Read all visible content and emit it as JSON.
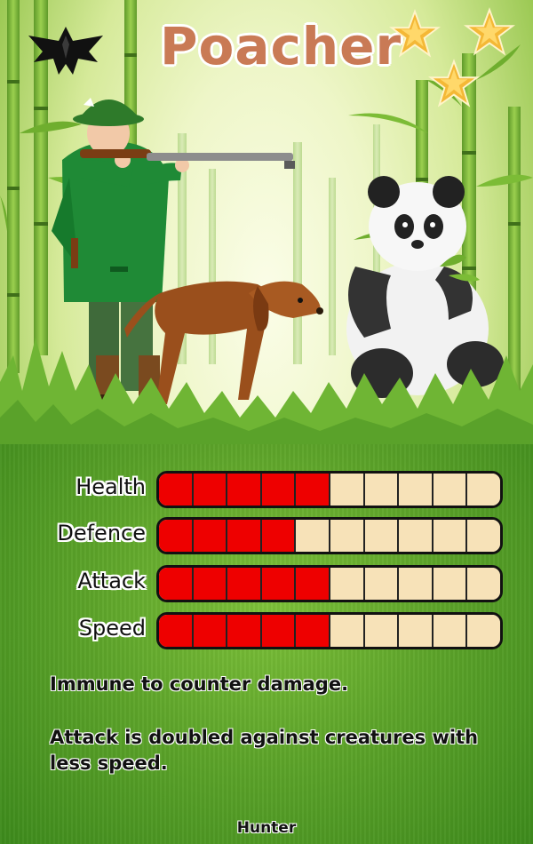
{
  "card": {
    "title": "Poacher",
    "star_count": 3,
    "stats": [
      {
        "label": "Health",
        "value": 5,
        "max": 10
      },
      {
        "label": "Defence",
        "value": 4,
        "max": 10
      },
      {
        "label": "Attack",
        "value": 5,
        "max": 10
      },
      {
        "label": "Speed",
        "value": 5,
        "max": 10
      }
    ],
    "abilities": [
      "Immune to counter damage.",
      "Attack is doubled against creatures with less speed."
    ],
    "footer": "Hunter"
  },
  "colors": {
    "title": "#c97a55",
    "bar_filled": "#ee0000",
    "bar_empty": "#f7e2b8",
    "grass": "#5ea52a"
  },
  "icons": {
    "logo": "bat-emblem-icon",
    "rating": "star-icon"
  }
}
